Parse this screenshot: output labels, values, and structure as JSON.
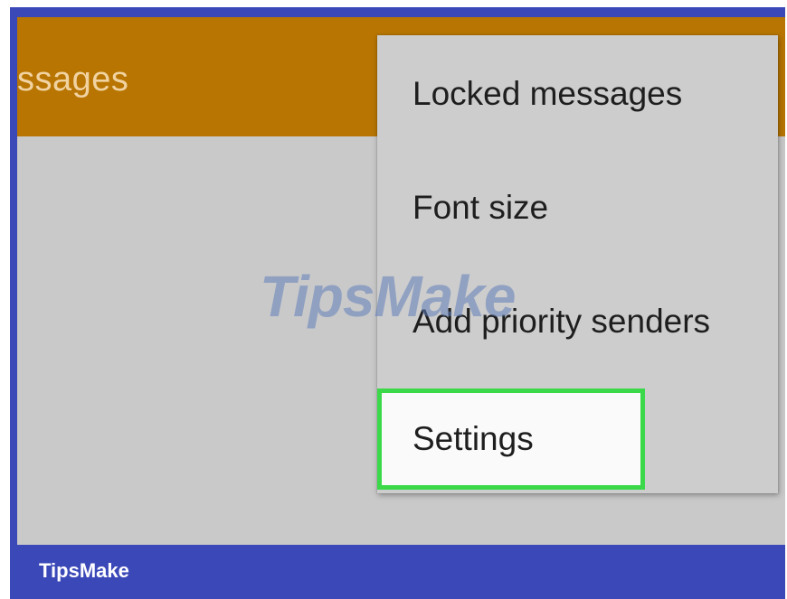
{
  "app_bar": {
    "title_fragment": "ssages",
    "color": "#b87502"
  },
  "overflow_menu": {
    "items": [
      {
        "label": "Locked messages"
      },
      {
        "label": "Font size"
      },
      {
        "label": "Add priority senders"
      },
      {
        "label": "Settings",
        "highlighted": true
      }
    ],
    "highlight_color": "#3bd94a"
  },
  "watermark": {
    "text": "TipsMake"
  },
  "brand": {
    "label": "TipsMake",
    "frame_color": "#3b48b8"
  }
}
